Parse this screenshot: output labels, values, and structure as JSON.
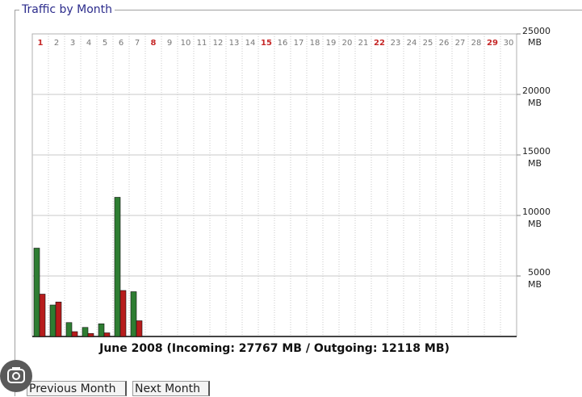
{
  "panel": {
    "legend": "Traffic by Month"
  },
  "chart_data": {
    "type": "bar",
    "categories": [
      "1",
      "2",
      "3",
      "4",
      "5",
      "6",
      "7",
      "8",
      "9",
      "10",
      "11",
      "12",
      "13",
      "14",
      "15",
      "16",
      "17",
      "18",
      "19",
      "20",
      "21",
      "22",
      "23",
      "24",
      "25",
      "26",
      "27",
      "28",
      "29",
      "30"
    ],
    "weekend_days": [
      "1",
      "8",
      "15",
      "22",
      "29"
    ],
    "series": [
      {
        "values": [
          7300,
          2600,
          1150,
          750,
          1050,
          11500,
          3700,
          0,
          0,
          0,
          0,
          0,
          0,
          0,
          0,
          0,
          0,
          0,
          0,
          0,
          0,
          0,
          0,
          0,
          0,
          0,
          0,
          0,
          0,
          0
        ],
        "color": "#2e7d32"
      },
      {
        "values": [
          3500,
          2850,
          400,
          250,
          300,
          3800,
          1300,
          0,
          0,
          0,
          0,
          0,
          0,
          0,
          0,
          0,
          0,
          0,
          0,
          0,
          0,
          0,
          0,
          0,
          0,
          0,
          0,
          0,
          0,
          0
        ],
        "color": "#b71c1c"
      }
    ],
    "y_ticks": [
      {
        "value": 25000,
        "label": "25000",
        "unit": "MB"
      },
      {
        "value": 20000,
        "label": "20000",
        "unit": "MB"
      },
      {
        "value": 15000,
        "label": "15000",
        "unit": "MB"
      },
      {
        "value": 10000,
        "label": "10000",
        "unit": "MB"
      },
      {
        "value": 5000,
        "label": "5000",
        "unit": "MB"
      }
    ],
    "ylim": [
      0,
      25000
    ],
    "grid": true,
    "caption": "June 2008 (Incoming: 27767 MB / Outgoing: 12118 MB)"
  },
  "nav": {
    "previous_label": "Previous Month",
    "next_label": "Next Month"
  },
  "colors": {
    "incoming": "#2e7d32",
    "outgoing": "#b71c1c",
    "weekend_label": "#c62828",
    "weekday_label": "#777777",
    "legend_text": "#2c2c8c"
  }
}
